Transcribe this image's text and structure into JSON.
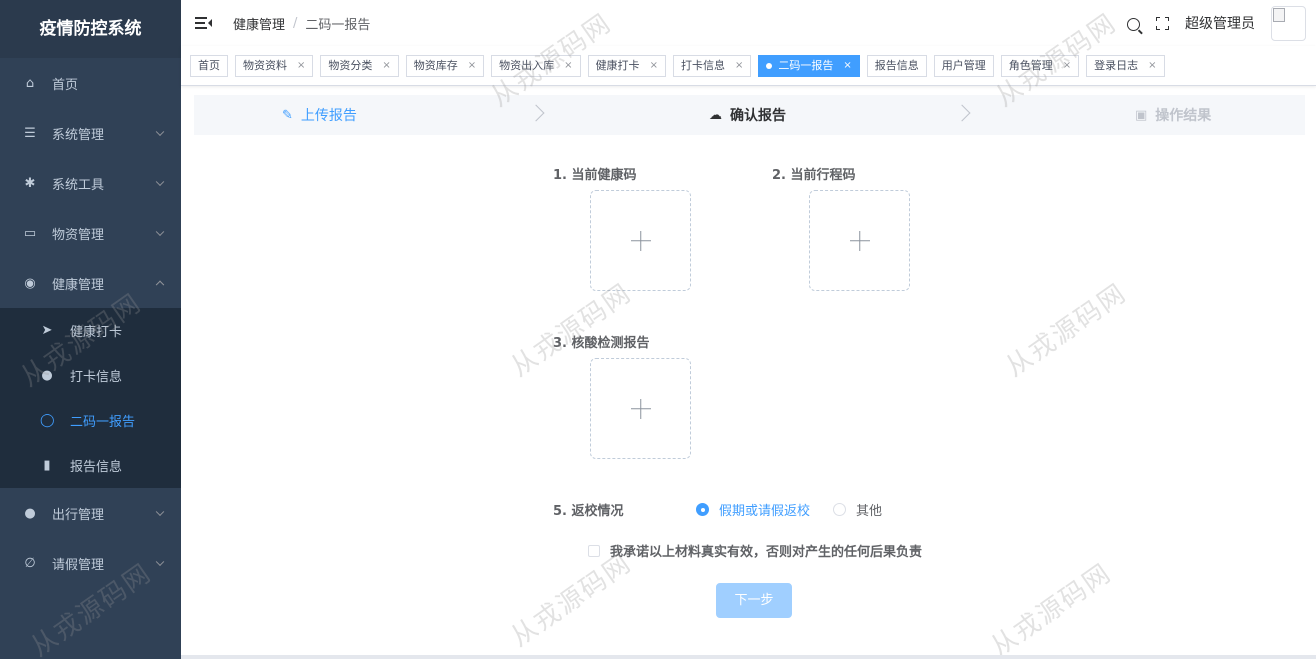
{
  "app": {
    "title": "疫情防控系统"
  },
  "sidebar": {
    "items": [
      {
        "label": "首页",
        "icon": "home-icon",
        "glyph": "⌂"
      },
      {
        "label": "系统管理",
        "icon": "sliders-icon",
        "glyph": "☰"
      },
      {
        "label": "系统工具",
        "icon": "gear-icon",
        "glyph": "✱"
      },
      {
        "label": "物资管理",
        "icon": "bag-icon",
        "glyph": "▭"
      },
      {
        "label": "健康管理",
        "icon": "location-icon",
        "glyph": "◉"
      }
    ],
    "sub_items": [
      {
        "label": "健康打卡",
        "icon": "paper-plane-icon",
        "glyph": "➤"
      },
      {
        "label": "打卡信息",
        "icon": "bulb-icon",
        "glyph": "●"
      },
      {
        "label": "二码一报告",
        "icon": "chat-bubble-icon",
        "glyph": "◯"
      },
      {
        "label": "报告信息",
        "icon": "bar-chart-icon",
        "glyph": "▮"
      }
    ],
    "bottom_items": [
      {
        "label": "出行管理",
        "icon": "user-icon",
        "glyph": "●"
      },
      {
        "label": "请假管理",
        "icon": "paperclip-icon",
        "glyph": "∅"
      }
    ]
  },
  "header": {
    "breadcrumb": [
      "健康管理",
      "二码一报告"
    ],
    "breadcrumb_sep": "/",
    "username": "超级管理员"
  },
  "tags": [
    {
      "label": "首页",
      "closable": false
    },
    {
      "label": "物资资料",
      "closable": true
    },
    {
      "label": "物资分类",
      "closable": true
    },
    {
      "label": "物资库存",
      "closable": true
    },
    {
      "label": "物资出入库",
      "closable": true
    },
    {
      "label": "健康打卡",
      "closable": true
    },
    {
      "label": "打卡信息",
      "closable": true
    },
    {
      "label": "二码一报告",
      "closable": true,
      "active": true
    },
    {
      "label": "报告信息",
      "closable": false
    },
    {
      "label": "用户管理",
      "closable": false
    },
    {
      "label": "角色管理",
      "closable": true
    },
    {
      "label": "登录日志",
      "closable": true
    }
  ],
  "tag_close_glyph": "×",
  "steps": [
    {
      "label": "上传报告",
      "icon": "edit-icon",
      "glyph": "✎"
    },
    {
      "label": "确认报告",
      "icon": "upload-cloud-icon",
      "glyph": "☁"
    },
    {
      "label": "操作结果",
      "icon": "picture-icon",
      "glyph": "▣"
    }
  ],
  "form": {
    "health_code_label": "1. 当前健康码",
    "trip_code_label": "2. 当前行程码",
    "nucleic_label": "3. 核酸检测报告",
    "return_label": "5. 返校情况",
    "return_options": [
      "假期或请假返校",
      "其他"
    ],
    "return_selected": "假期或请假返校",
    "promise_text": "我承诺以上材料真实有效，否则对产生的任何后果负责",
    "next_button": "下一步"
  },
  "watermark": "从戎源码网",
  "colors": {
    "primary": "#409eff",
    "sidebar_bg": "#304156",
    "submenu_bg": "#1f2d3d",
    "disabled_btn": "#a0cfff"
  }
}
